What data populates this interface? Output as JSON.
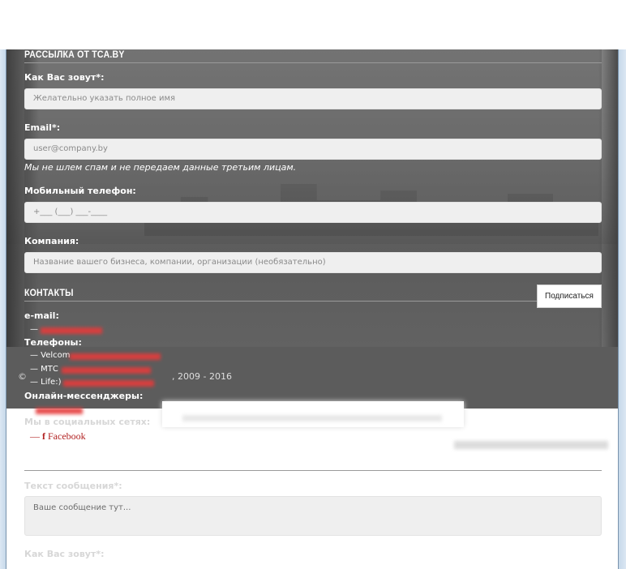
{
  "subscribe_section": {
    "header": "РАССЫЛКА ОТ TCA.BY",
    "name_label": "Как Вас зовут*:",
    "name_placeholder": "Желательно указать полное имя",
    "email_label": "Email*:",
    "email_placeholder": "user@company.by",
    "spam_note": "Мы не шлем спам и не передаем данные третьим лицам.",
    "phone_label": "Мобильный телефон:",
    "phone_placeholder": "+___ (___) ___-____",
    "company_label": "Компания:",
    "company_placeholder": "Название вашего бизнеса, компании, организации (необязательно)",
    "subscribe_button": "Подписаться"
  },
  "contacts": {
    "header": "КОНТАКТЫ",
    "email_label": "e-mail:",
    "email_dash": "—",
    "phones_label": "Телефоны:",
    "phones": [
      {
        "label": "— Velcom"
      },
      {
        "label": "— МТС"
      },
      {
        "label": "— Life:)"
      }
    ],
    "messengers_label": "Онлайн-мессенджеры:",
    "social_label": "Мы в социальных сетях:",
    "facebook_dash": "—",
    "facebook_icon": "f",
    "facebook_label": "Facebook"
  },
  "footer": {
    "copyright_symbol": "©",
    "years": ", 2009 - 2016"
  },
  "message_form": {
    "message_label": "Текст сообщения*:",
    "message_placeholder": "Ваше сообщение тут...",
    "name_label": "Как Вас зовут*:"
  },
  "colors": {
    "accent_red": "#b22222",
    "footer_band": "#5c5c5c",
    "field_bg": "#efefef"
  }
}
